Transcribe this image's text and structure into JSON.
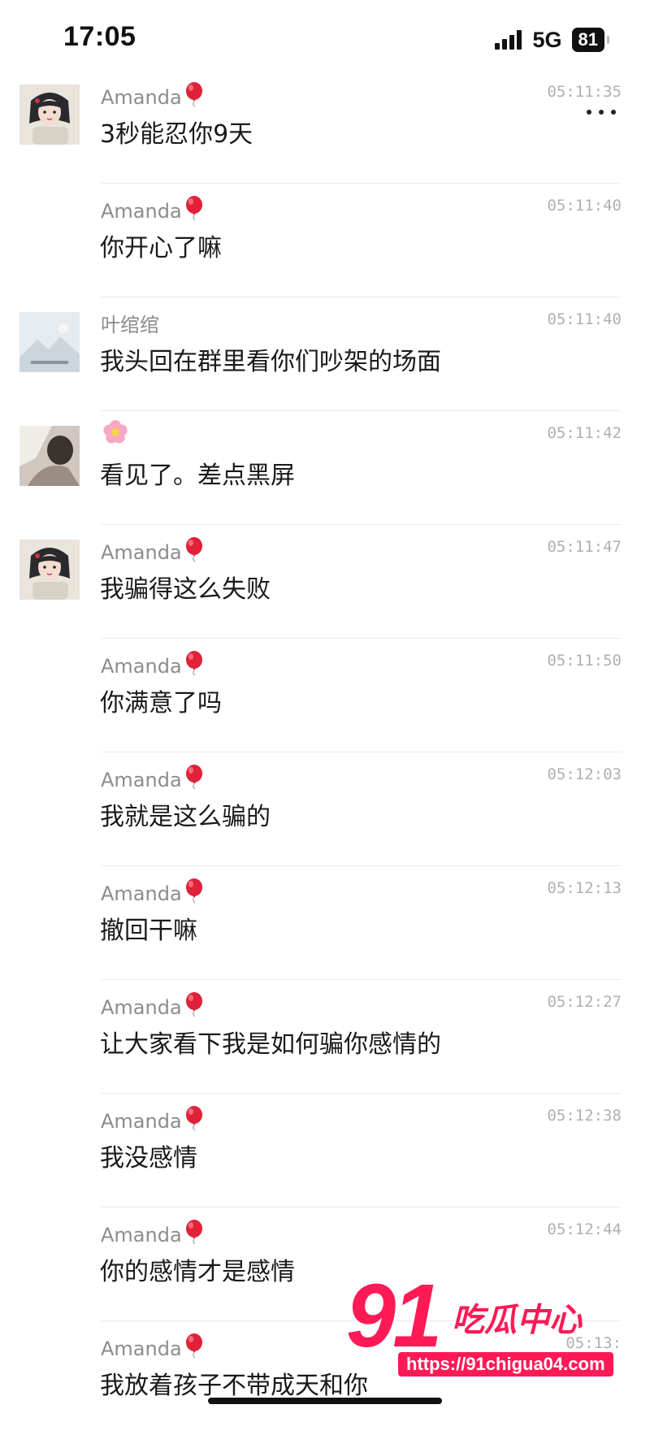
{
  "status_bar": {
    "time": "17:05",
    "network": "5G",
    "battery": "81"
  },
  "colors": {
    "balloon": "#e0213a",
    "watermark": "#ff1a56"
  },
  "messages": [
    {
      "sender": "Amanda",
      "time": "05:11:35",
      "text": "3秒能忍你9天",
      "avatar": "amanda"
    },
    {
      "sender": "Amanda",
      "time": "05:11:40",
      "text": "你开心了嘛",
      "avatar": "none"
    },
    {
      "sender": "叶绾绾",
      "time": "05:11:40",
      "text": "我头回在群里看你们吵架的场面",
      "avatar": "landscape"
    },
    {
      "sender": "",
      "time": "05:11:42",
      "text": "看见了。差点黑屏",
      "avatar": "photo"
    },
    {
      "sender": "Amanda",
      "time": "05:11:47",
      "text": "我骗得这么失败",
      "avatar": "amanda"
    },
    {
      "sender": "Amanda",
      "time": "05:11:50",
      "text": "你满意了吗",
      "avatar": "none"
    },
    {
      "sender": "Amanda",
      "time": "05:12:03",
      "text": "我就是这么骗的",
      "avatar": "none"
    },
    {
      "sender": "Amanda",
      "time": "05:12:13",
      "text": "撤回干嘛",
      "avatar": "none"
    },
    {
      "sender": "Amanda",
      "time": "05:12:27",
      "text": "让大家看下我是如何骗你感情的",
      "avatar": "none"
    },
    {
      "sender": "Amanda",
      "time": "05:12:38",
      "text": "我没感情",
      "avatar": "none"
    },
    {
      "sender": "Amanda",
      "time": "05:12:44",
      "text": "你的感情才是感情",
      "avatar": "none"
    },
    {
      "sender": "Amanda",
      "time": "05:13:",
      "text": "我放着孩子不带成天和你",
      "avatar": "none"
    }
  ],
  "watermark": {
    "number": "91",
    "title": "吃瓜中心",
    "url": "https://91chigua04.com"
  }
}
